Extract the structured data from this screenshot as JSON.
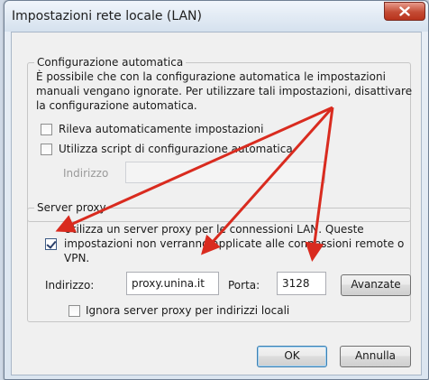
{
  "window": {
    "title": "Impostazioni rete locale (LAN)",
    "close_icon": "close-icon"
  },
  "auto_config": {
    "legend": "Configurazione automatica",
    "description_lines": [
      "È possibile che con la configurazione automatica le impostazioni",
      "manuali vengano ignorate. Per utilizzare tali impostazioni, disattivare",
      "la configurazione automatica."
    ],
    "detect_label": "Rileva automaticamente impostazioni",
    "detect_checked": false,
    "script_label": "Utilizza script di configurazione automatica",
    "script_checked": false,
    "address_label": "Indirizzo",
    "address_value": ""
  },
  "proxy": {
    "legend": "Server proxy",
    "use_proxy_lines": [
      "Utilizza un server proxy per le connessioni LAN. Queste",
      "impostazioni non verranno applicate alle connessioni remote o",
      "VPN."
    ],
    "use_proxy_checked": true,
    "address_label": "Indirizzo:",
    "address_value": "proxy.unina.it",
    "port_label": "Porta:",
    "port_value": "3128",
    "advanced_button": "Avanzate",
    "bypass_label": "Ignora server proxy per indirizzi locali",
    "bypass_checked": false
  },
  "buttons": {
    "ok": "OK",
    "cancel": "Annulla"
  },
  "annotation_color": "#d92b1f"
}
